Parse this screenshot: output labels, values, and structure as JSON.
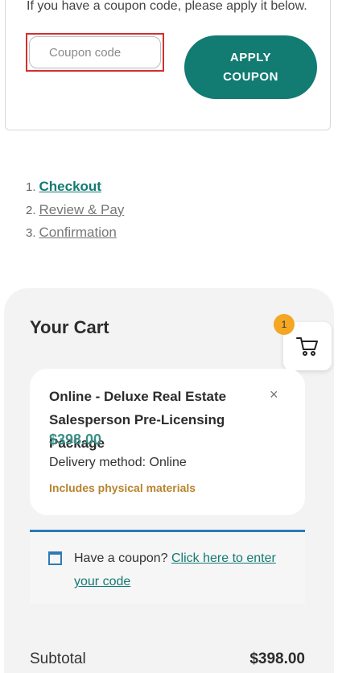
{
  "coupon_form": {
    "hint": "If you have a coupon code, please apply it below.",
    "input_placeholder": "Coupon code",
    "input_value": "",
    "apply_label": "APPLY\nCOUPON"
  },
  "steps": [
    {
      "num": "1.",
      "label": "Checkout"
    },
    {
      "num": "2.",
      "label": "Review & Pay"
    },
    {
      "num": "3.",
      "label": "Confirmation"
    }
  ],
  "cart": {
    "title": "Your Cart",
    "badge_count": "1",
    "item": {
      "name": "Online - Deluxe Real Estate Salesperson Pre-Licensing Package",
      "price": "$398.00",
      "delivery": "Delivery method: Online",
      "materials": "Includes physical materials",
      "remove_symbol": "×"
    },
    "coupon_prompt": "Have a coupon?",
    "coupon_link": "Click here to enter your code",
    "subtotal_label": "Subtotal",
    "subtotal_value": "$398.00"
  },
  "colors": {
    "accent": "#127b72",
    "badge": "#f5a623",
    "materials": "#b7842e",
    "info_border": "#2d7bb5"
  }
}
